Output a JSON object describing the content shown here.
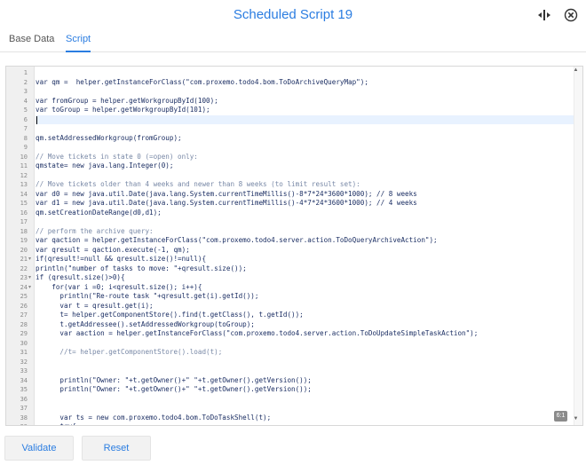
{
  "header": {
    "title": "Scheduled Script 19",
    "icons": {
      "expand": "resize-horizontal-icon",
      "close": "close-circle-icon"
    }
  },
  "tabs": [
    {
      "label": "Base Data",
      "active": false
    },
    {
      "label": "Script",
      "active": true
    }
  ],
  "editor": {
    "lines": [
      {
        "n": "1",
        "text": ""
      },
      {
        "n": "2",
        "text": "var qm =  helper.getInstanceForClass(\"com.proxemo.todo4.bom.ToDoArchiveQueryMap\");"
      },
      {
        "n": "3",
        "text": ""
      },
      {
        "n": "4",
        "text": "var fromGroup = helper.getWorkgroupById(100);"
      },
      {
        "n": "5",
        "text": "var toGroup = helper.getWorkgroupById(101);"
      },
      {
        "n": "6",
        "text": "",
        "active": true
      },
      {
        "n": "7",
        "text": ""
      },
      {
        "n": "8",
        "text": "qm.setAddressedWorkgroup(fromGroup);"
      },
      {
        "n": "9",
        "text": ""
      },
      {
        "n": "10",
        "text": "// Move tickets in state 0 (=open) only:",
        "comment": true
      },
      {
        "n": "11",
        "text": "qmstate= new java.lang.Integer(0);"
      },
      {
        "n": "12",
        "text": ""
      },
      {
        "n": "13",
        "text": "// Move tickets older than 4 weeks and newer than 8 weeks (to limit result set):",
        "comment": true
      },
      {
        "n": "14",
        "text": "var d0 = new java.util.Date(java.lang.System.currentTimeMillis()-8*7*24*3600*1000); // 8 weeks"
      },
      {
        "n": "15",
        "text": "var d1 = new java.util.Date(java.lang.System.currentTimeMillis()-4*7*24*3600*1000); // 4 weeks"
      },
      {
        "n": "16",
        "text": "qm.setCreationDateRange(d0,d1);"
      },
      {
        "n": "17",
        "text": ""
      },
      {
        "n": "18",
        "text": "// perform the archive query:",
        "comment": true
      },
      {
        "n": "19",
        "text": "var qaction = helper.getInstanceForClass(\"com.proxemo.todo4.server.action.ToDoQueryArchiveAction\");"
      },
      {
        "n": "20",
        "text": "var qresult = qaction.execute(-1, qm);"
      },
      {
        "n": "21",
        "text": "if(qresult!=null && qresult.size()!=null){",
        "fold": true
      },
      {
        "n": "22",
        "text": "println(\"number of tasks to move: \"+qresult.size());"
      },
      {
        "n": "23",
        "text": "if (qresult.size()>0){",
        "fold": true
      },
      {
        "n": "24",
        "text": "    for(var i =0; i<qresult.size(); i++){",
        "fold": true
      },
      {
        "n": "25",
        "text": "      println(\"Re-route task \"+qresult.get(i).getId());"
      },
      {
        "n": "26",
        "text": "      var t = qresult.get(i);"
      },
      {
        "n": "27",
        "text": "      t= helper.getComponentStore().find(t.getClass(), t.getId());"
      },
      {
        "n": "28",
        "text": "      t.getAddressee().setAddressedWorkgroup(toGroup);"
      },
      {
        "n": "29",
        "text": "      var aaction = helper.getInstanceForClass(\"com.proxemo.todo4.server.action.ToDoUpdateSimpleTaskAction\");"
      },
      {
        "n": "30",
        "text": ""
      },
      {
        "n": "31",
        "text": "      //t= helper.getComponentStore().load(t);",
        "comment": true
      },
      {
        "n": "32",
        "text": ""
      },
      {
        "n": "33",
        "text": ""
      },
      {
        "n": "34",
        "text": "      println(\"Owner: \"+t.getOwner()+\" \"+t.getOwner().getVersion());"
      },
      {
        "n": "35",
        "text": "      println(\"Owner: \"+t.getOwner()+\" \"+t.getOwner().getVersion());"
      },
      {
        "n": "36",
        "text": ""
      },
      {
        "n": "37",
        "text": ""
      },
      {
        "n": "38",
        "text": "      var ts = new com.proxemo.todo4.bom.ToDoTaskShell(t);"
      },
      {
        "n": "39",
        "text": "      try{",
        "fold": true
      }
    ],
    "zoom_badge": "6:1"
  },
  "buttons": {
    "validate": "Validate",
    "reset": "Reset"
  }
}
